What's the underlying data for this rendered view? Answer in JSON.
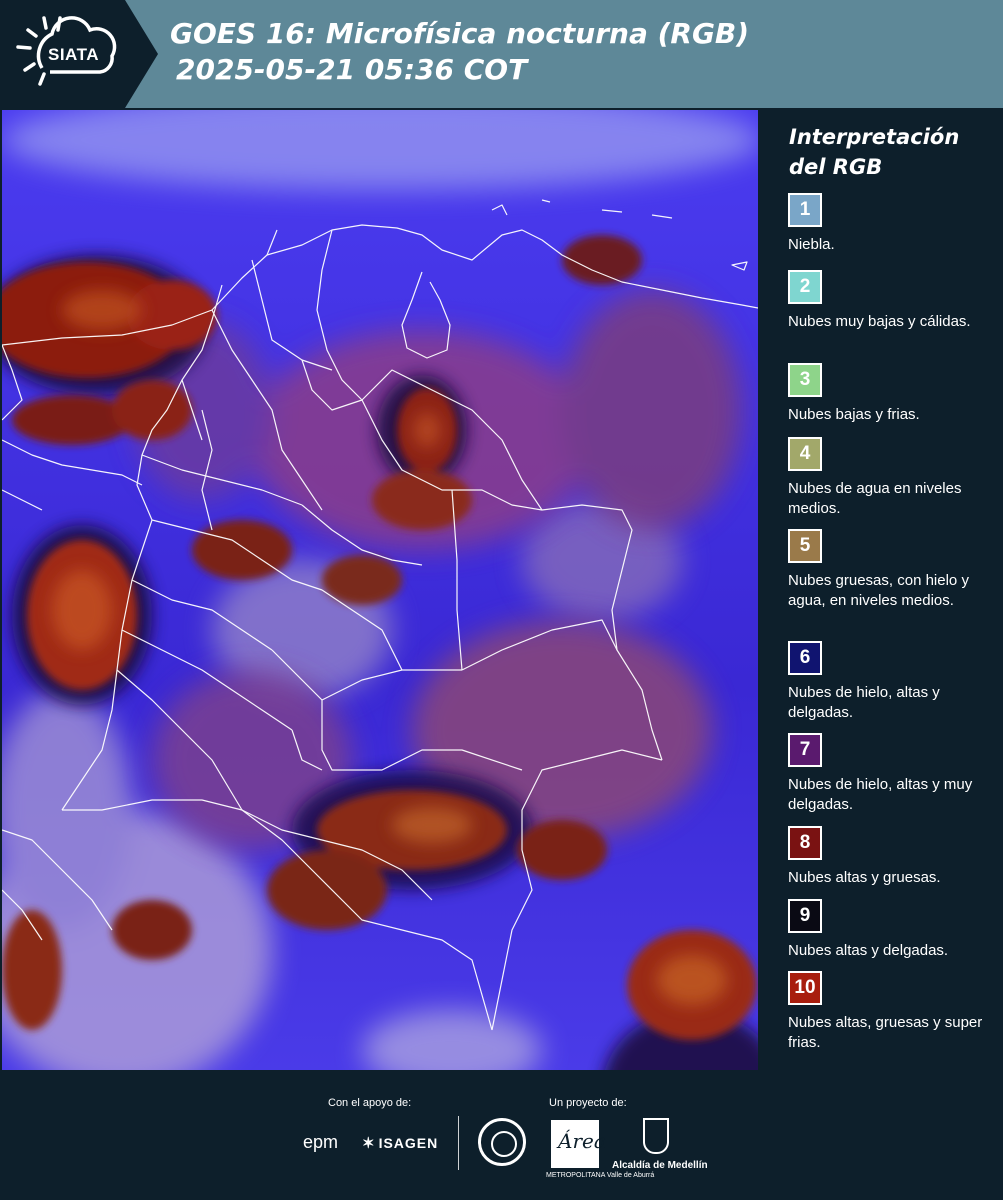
{
  "header": {
    "logo_label": "SIATA",
    "title_line1": "GOES 16: Microfísica nocturna (RGB)",
    "title_line2": "2025-05-21 05:36 COT"
  },
  "legend": {
    "title_line1": "Interpretación",
    "title_line2": "del RGB",
    "items": [
      {
        "number": "1",
        "label": "Niebla.",
        "color": "#7aa6c8"
      },
      {
        "number": "2",
        "label": "Nubes muy bajas y cálidas.",
        "color": "#7fd6d0"
      },
      {
        "number": "3",
        "label": "Nubes bajas y frias.",
        "color": "#8ed48a"
      },
      {
        "number": "4",
        "label": "Nubes de agua en niveles medios.",
        "color": "#a2a86a"
      },
      {
        "number": "5",
        "label": "Nubes gruesas, con hielo y agua, en niveles medios.",
        "color": "#9a7a4a"
      },
      {
        "number": "6",
        "label": "Nubes de hielo, altas y delgadas.",
        "color": "#101470"
      },
      {
        "number": "7",
        "label": "Nubes de hielo, altas y muy delgadas.",
        "color": "#5a1a6e"
      },
      {
        "number": "8",
        "label": "Nubes altas y gruesas.",
        "color": "#7a1212"
      },
      {
        "number": "9",
        "label": "Nubes altas y delgadas.",
        "color": "#0a0a14"
      },
      {
        "number": "10",
        "label": "Nubes altas, gruesas y super frias.",
        "color": "#a81e0e"
      }
    ]
  },
  "footer": {
    "support_label": "Con el apoyo de:",
    "project_label": "Un proyecto de:",
    "epm": "epm",
    "isagen": "ISAGEN",
    "area_logo": "Área",
    "area_text": "METROPOLITANA Valle de Aburrá",
    "alcaldia": "Alcaldía de Medellín"
  }
}
